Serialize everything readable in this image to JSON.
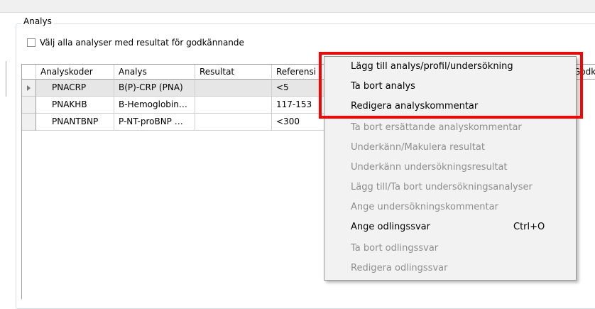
{
  "group": {
    "title": "Analys"
  },
  "checkbox": {
    "label": "Välj alla analyser med resultat för godkännande",
    "checked": false
  },
  "table": {
    "columns": [
      "Analyskoder",
      "Analys",
      "Resultat",
      "Referensi",
      "Godk."
    ],
    "rows": [
      {
        "code": "PNACRP",
        "analys": "B(P)-CRP (PNA)",
        "resultat": "",
        "referens": "<5",
        "selected": true
      },
      {
        "code": "PNAKHB",
        "analys": "B-Hemoglobin…",
        "resultat": "",
        "referens": "117-153",
        "selected": false
      },
      {
        "code": "PNANTBNP",
        "analys": "P-NT-proBNP …",
        "resultat": "",
        "referens": "<300",
        "selected": false
      }
    ]
  },
  "context_menu": {
    "items": [
      {
        "label": "Lägg till analys/profil/undersökning",
        "enabled": true
      },
      {
        "label": "Ta bort analys",
        "enabled": true
      },
      {
        "label": "Redigera analyskommentar",
        "enabled": true
      },
      {
        "label": "Ta bort ersättande analyskommentar",
        "enabled": false
      },
      {
        "label": "Underkänn/Makulera resultat",
        "enabled": false
      },
      {
        "label": "Underkänn undersökningsresultat",
        "enabled": false
      },
      {
        "label": "Lägg till/Ta bort undersökningsanalyser",
        "enabled": false
      },
      {
        "label": "Ange undersökningskommentar",
        "enabled": false
      },
      {
        "label": "Ange odlingssvar",
        "enabled": true,
        "shortcut": "Ctrl+O"
      },
      {
        "label": "Ta bort odlingssvar",
        "enabled": false
      },
      {
        "label": "Redigera odlingssvar",
        "enabled": false
      }
    ]
  },
  "colors": {
    "highlight": "#ff0000",
    "disabled_text": "#8e8e8e",
    "menu_bg": "#f2f2f2"
  }
}
